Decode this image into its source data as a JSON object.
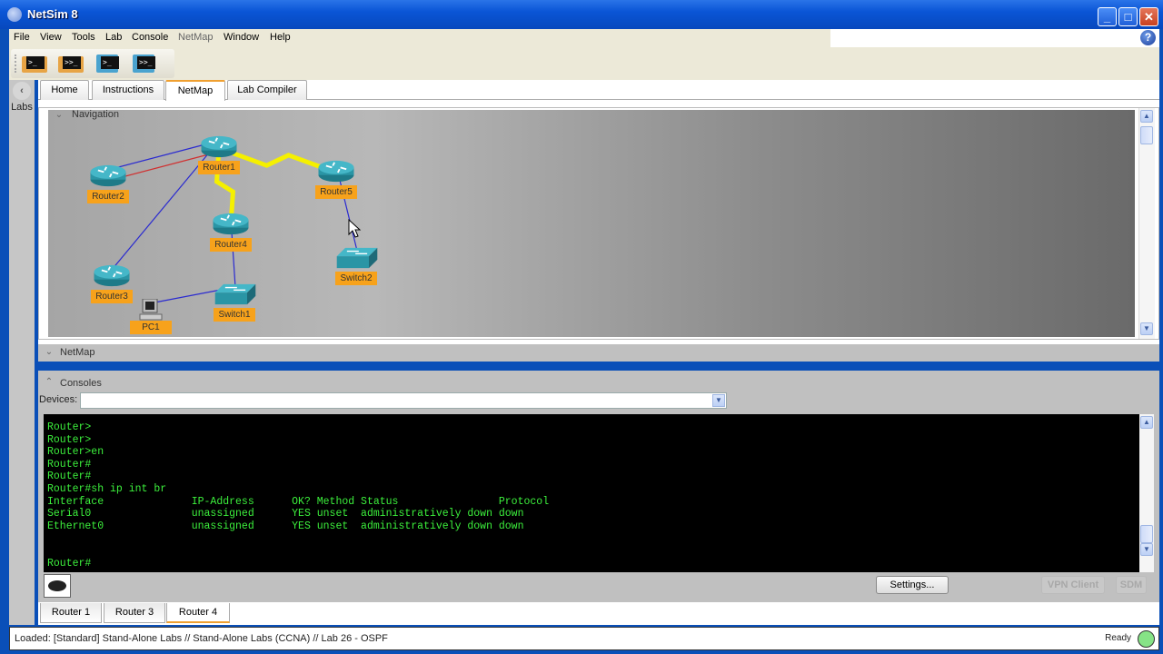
{
  "window": {
    "title": "NetSim 8",
    "controls": {
      "minimize": "_",
      "maximize": "□",
      "close": "✕"
    }
  },
  "menu": {
    "items": [
      {
        "label": "File",
        "enabled": true
      },
      {
        "label": "View",
        "enabled": true
      },
      {
        "label": "Tools",
        "enabled": true
      },
      {
        "label": "Lab",
        "enabled": true
      },
      {
        "label": "Console",
        "enabled": true
      },
      {
        "label": "NetMap",
        "enabled": false
      },
      {
        "label": "Window",
        "enabled": true
      },
      {
        "label": "Help",
        "enabled": true
      }
    ],
    "help_icon": "?"
  },
  "toolbar": {
    "buttons": [
      {
        "icon": "open-console-icon",
        "glyph": ">_"
      },
      {
        "icon": "open-multiple-consoles-icon",
        "glyph": ">>_"
      },
      {
        "icon": "save-console-icon",
        "glyph": ">_"
      },
      {
        "icon": "save-all-consoles-icon",
        "glyph": ">>_"
      }
    ]
  },
  "labs_panel": {
    "label": "Labs",
    "collapse_glyph": "‹"
  },
  "main_tabs": [
    {
      "label": "Home",
      "active": false
    },
    {
      "label": "Instructions",
      "active": false
    },
    {
      "label": "NetMap",
      "active": true
    },
    {
      "label": "Lab Compiler",
      "active": false
    }
  ],
  "navigation": {
    "title": "Navigation",
    "devices": [
      {
        "name": "Router1",
        "type": "router"
      },
      {
        "name": "Router2",
        "type": "router"
      },
      {
        "name": "Router3",
        "type": "router"
      },
      {
        "name": "Router4",
        "type": "router"
      },
      {
        "name": "Router5",
        "type": "router"
      },
      {
        "name": "Switch1",
        "type": "switch"
      },
      {
        "name": "Switch2",
        "type": "switch"
      },
      {
        "name": "PC1",
        "type": "pc"
      }
    ],
    "links": [
      {
        "from": "Router2",
        "to": "Router1",
        "type": "ethernet",
        "color": "#2a2ad0"
      },
      {
        "from": "Router2",
        "to": "Router1",
        "type": "crossover",
        "color": "#d03030"
      },
      {
        "from": "Router3",
        "to": "Router1",
        "type": "ethernet",
        "color": "#2a2ad0"
      },
      {
        "from": "Router1",
        "to": "Router5",
        "type": "serial",
        "color": "#f5f000"
      },
      {
        "from": "Router1",
        "to": "Router4",
        "type": "serial",
        "color": "#f5f000"
      },
      {
        "from": "Router4",
        "to": "Switch1",
        "type": "ethernet",
        "color": "#2a2ad0"
      },
      {
        "from": "PC1",
        "to": "Switch1",
        "type": "ethernet",
        "color": "#2a2ad0"
      },
      {
        "from": "Router5",
        "to": "Switch2",
        "type": "ethernet",
        "color": "#2a2ad0"
      }
    ]
  },
  "netmap_section": {
    "title": "NetMap"
  },
  "consoles": {
    "title": "Consoles",
    "devices_label": "Devices:",
    "devices_value": "",
    "terminal_lines": [
      "Router>",
      "Router>",
      "Router>en",
      "Router#",
      "Router#",
      "Router#sh ip int br",
      "Interface              IP-Address      OK? Method Status                Protocol",
      "Serial0                unassigned      YES unset  administratively down down",
      "Ethernet0              unassigned      YES unset  administratively down down",
      "",
      "",
      "Router#"
    ],
    "settings_button": "Settings...",
    "vpn_button": "VPN Client",
    "sdm_button": "SDM"
  },
  "console_tabs": [
    {
      "label": "Router 1",
      "active": false
    },
    {
      "label": "Router 3",
      "active": false
    },
    {
      "label": "Router 4",
      "active": true
    }
  ],
  "status": {
    "text": "Loaded: [Standard] Stand-Alone Labs // Stand-Alone Labs (CCNA) // Lab 26 - OSPF",
    "ready": "Ready",
    "ready_color": "#86e386"
  },
  "colors": {
    "accent_tab": "#f0a030",
    "device_label_bg": "#f7a21b",
    "terminal_text": "#3cf03c",
    "frame_blue": "#0a4fb8"
  }
}
